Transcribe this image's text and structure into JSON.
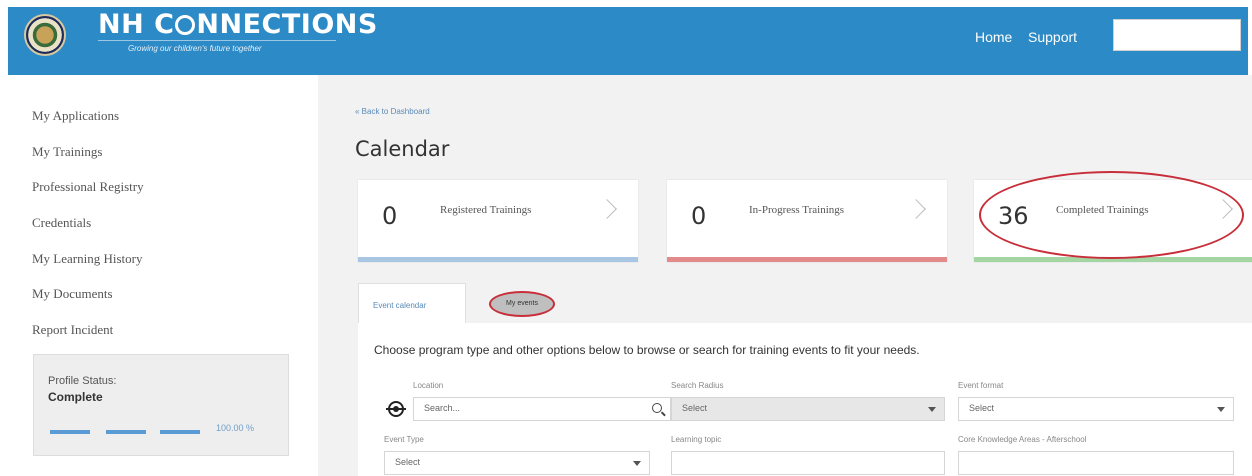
{
  "header": {
    "brand": "NH CONNECTIONS",
    "brand_left": "NH C",
    "brand_right": "NNECTIONS",
    "tagline": "Growing our children's future together",
    "nav": [
      "Home",
      "Support"
    ]
  },
  "sidebar": {
    "items": [
      "My Applications",
      "My Trainings",
      "Professional Registry",
      "Credentials",
      "My Learning History",
      "My Documents",
      "Report Incident"
    ],
    "profile": {
      "label": "Profile Status:",
      "value": "Complete",
      "percent_text": "100.00 %",
      "percent": 100
    }
  },
  "main": {
    "back_link": "« Back to Dashboard",
    "title": "Calendar",
    "stats": [
      {
        "count": "0",
        "label": "Registered Trainings",
        "color": "#5b9bd5"
      },
      {
        "count": "0",
        "label": "In-Progress Trainings",
        "color": "#e07070"
      },
      {
        "count": "36",
        "label": "Completed Trainings",
        "color": "#7cc47c"
      }
    ],
    "tabs": [
      "Event calendar",
      "My events"
    ],
    "intro": "Choose program type and other options below to browse or search for training events to fit your needs.",
    "filters": {
      "location_label": "Location",
      "location_placeholder": "Search...",
      "radius_label": "Search Radius",
      "radius_value": "Select",
      "format_label": "Event format",
      "format_value": "Select",
      "type_label": "Event Type",
      "type_value": "Select",
      "topic_label": "Learning topic",
      "cka_label": "Core Knowledge Areas - Afterschool"
    }
  },
  "annotation_color": "#c72e3a"
}
